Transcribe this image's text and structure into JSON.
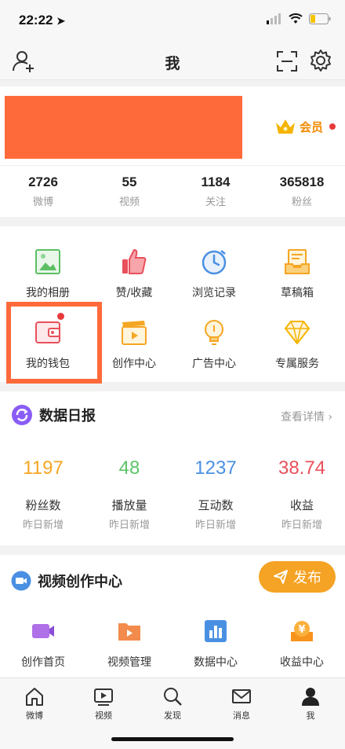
{
  "status": {
    "time": "22:22"
  },
  "nav": {
    "title": "我"
  },
  "profile": {
    "vip_label": "会员",
    "stats": [
      {
        "value": "2726",
        "label": "微博"
      },
      {
        "value": "55",
        "label": "视频"
      },
      {
        "value": "1184",
        "label": "关注"
      },
      {
        "value": "365818",
        "label": "粉丝"
      }
    ]
  },
  "tools": {
    "items": [
      {
        "label": "我的相册",
        "icon": "photo-album-icon"
      },
      {
        "label": "赞/收藏",
        "icon": "thumbs-up-icon"
      },
      {
        "label": "浏览记录",
        "icon": "clock-icon"
      },
      {
        "label": "草稿箱",
        "icon": "drafts-tray-icon"
      },
      {
        "label": "我的钱包",
        "icon": "wallet-icon"
      },
      {
        "label": "创作中心",
        "icon": "clapperboard-icon"
      },
      {
        "label": "广告中心",
        "icon": "lightbulb-icon"
      },
      {
        "label": "专属服务",
        "icon": "diamond-icon"
      }
    ]
  },
  "daily": {
    "title": "数据日报",
    "more": "查看详情 ›",
    "metrics": [
      {
        "value": "1197",
        "name": "粉丝数",
        "sub": "昨日新增",
        "color": "#f5a623"
      },
      {
        "value": "48",
        "name": "播放量",
        "sub": "昨日新增",
        "color": "#5cc46a"
      },
      {
        "value": "1237",
        "name": "互动数",
        "sub": "昨日新增",
        "color": "#4a90e2"
      },
      {
        "value": "38.74",
        "name": "收益",
        "sub": "昨日新增",
        "color": "#e8505b"
      }
    ]
  },
  "video": {
    "title": "视频创作中心",
    "publish_label": "发布",
    "tools": [
      {
        "label": "创作首页",
        "icon": "camera-icon"
      },
      {
        "label": "视频管理",
        "icon": "video-folder-icon"
      },
      {
        "label": "数据中心",
        "icon": "bar-chart-icon"
      },
      {
        "label": "收益中心",
        "icon": "coin-icon"
      }
    ]
  },
  "tabbar": {
    "items": [
      {
        "label": "微博",
        "icon": "home-icon"
      },
      {
        "label": "视频",
        "icon": "video-icon"
      },
      {
        "label": "发现",
        "icon": "search-icon"
      },
      {
        "label": "消息",
        "icon": "mail-icon"
      },
      {
        "label": "我",
        "icon": "person-icon"
      }
    ]
  }
}
